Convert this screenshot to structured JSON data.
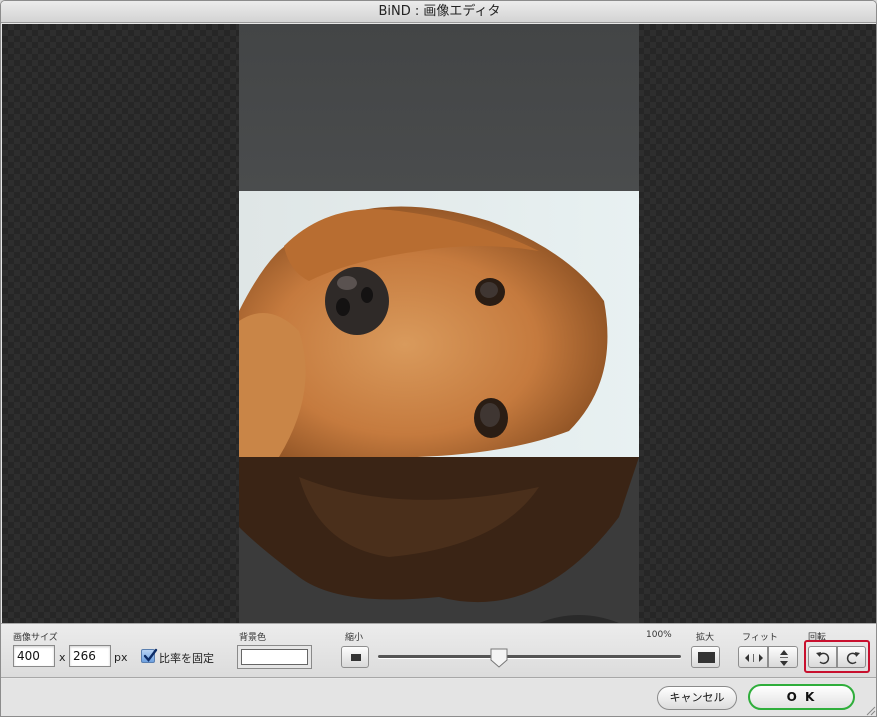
{
  "window": {
    "title": "BiND : 画像エディタ"
  },
  "toolbar": {
    "image_size_label": "画像サイズ",
    "width_value": "400",
    "times_label": "x",
    "height_value": "266",
    "unit_label": "px",
    "keep_ratio_label": "比率を固定",
    "keep_ratio_checked": true,
    "bg_color_label": "背景色",
    "bg_color_value": "#ffffff",
    "shrink_label": "縮小",
    "zoom_label": "100%",
    "zoom_fraction": 0.4,
    "enlarge_label": "拡大",
    "fit_label": "フィット",
    "rotate_label": "回転"
  },
  "icons": [
    "zoom-out-icon",
    "zoom-in-icon",
    "fit-width-icon",
    "fit-height-icon",
    "rotate-left-icon",
    "rotate-right-icon",
    "checkmark-icon",
    "resize-grip-icon"
  ],
  "buttons": {
    "cancel_label": "キャンセル",
    "ok_label": "O K"
  },
  "colors": {
    "ok_border": "#2fae3b",
    "rotate_highlight": "#c8102e",
    "canvas_bg": "#262626"
  }
}
